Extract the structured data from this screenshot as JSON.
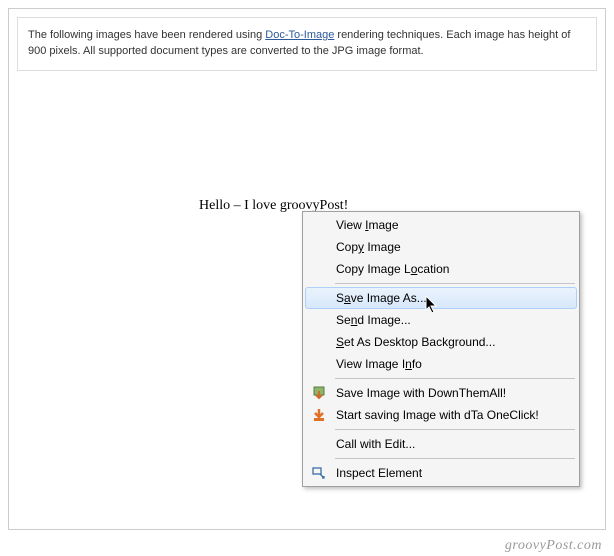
{
  "header": {
    "text_before_link": "The following images have been rendered using ",
    "link_text": "Doc-To-Image",
    "text_after_link": " rendering techniques. Each image has height of 900 pixels. All supported document types are converted to the JPG image format."
  },
  "document": {
    "body_text": "Hello – I love groovyPost!"
  },
  "context_menu": {
    "items": [
      {
        "label": "View Image",
        "key_index": 5,
        "icon": null,
        "highlighted": false
      },
      {
        "label": "Copy Image",
        "key_index": 3,
        "icon": null,
        "highlighted": false
      },
      {
        "label": "Copy Image Location",
        "key_index": 12,
        "icon": null,
        "highlighted": false
      },
      {
        "sep": true
      },
      {
        "label": "Save Image As...",
        "key_index": 1,
        "icon": null,
        "highlighted": true
      },
      {
        "label": "Send Image...",
        "key_index": 2,
        "icon": null,
        "highlighted": false
      },
      {
        "label": "Set As Desktop Background...",
        "key_index": 0,
        "icon": null,
        "highlighted": false
      },
      {
        "label": "View Image Info",
        "key_index": 12,
        "icon": null,
        "highlighted": false
      },
      {
        "sep": true
      },
      {
        "label": "Save Image with DownThemAll!",
        "key_index": -1,
        "icon": "dta-save-icon",
        "highlighted": false
      },
      {
        "label": "Start saving Image with dTa OneClick!",
        "key_index": -1,
        "icon": "dta-oneclick-icon",
        "highlighted": false
      },
      {
        "sep": true
      },
      {
        "label": "Call with Edit...",
        "key_index": -1,
        "icon": null,
        "highlighted": false
      },
      {
        "sep": true
      },
      {
        "label": "Inspect Element",
        "key_index": -1,
        "icon": "inspect-icon",
        "highlighted": false
      }
    ]
  },
  "watermark": "groovyPost.com"
}
